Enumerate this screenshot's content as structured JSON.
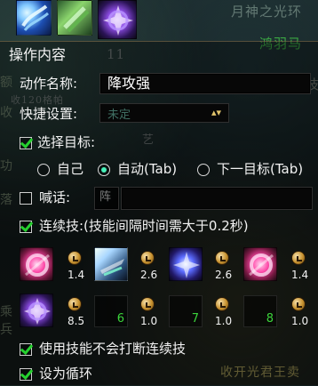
{
  "background": {
    "top_right_text": "月神之光环",
    "name_text": "鸿羽马",
    "level_text": "11",
    "right_side_text": "技",
    "left_side_text_1": "额",
    "left_side_text_2": "收",
    "left_side_text_3": "功",
    "left_side_text_4": "落",
    "left_side_text_5": "乘",
    "left_side_text_6": "兵",
    "bottom_right_text": "收开光君王卖",
    "small_left_text": "收120格帕",
    "small_mid_text": "艺"
  },
  "panel": {
    "header": "操作内容",
    "action_name_label": "动作名称:",
    "action_name_value": "降攻强",
    "shortcut_label": "快捷设置:",
    "shortcut_value": "未定",
    "select_target_label": "选择目标:",
    "radio_self": "自己",
    "radio_auto": "自动(Tab)",
    "radio_next": "下一目标(Tab)",
    "shout_label": "喊话:",
    "shout_placeholder": "阵",
    "combo_label": "连续技:(技能间隔时间需大于0.2秒)",
    "skill_row1": [
      "1.4",
      "2.6",
      "2.6",
      "1.4"
    ],
    "skill_row2": [
      "8.5",
      "1.0",
      "1.0",
      "1.0"
    ],
    "slot_numbers": [
      "6",
      "7",
      "8"
    ],
    "option_no_interrupt": "使用技能不会打断连续技",
    "option_loop": "设为循环"
  },
  "colors": {
    "checkmark": "#26d02f",
    "radio_selected": "#47f0b9",
    "slot_number": "#3bd43b"
  },
  "icons": [
    "wind-skill-icon",
    "leaf-skill-icon",
    "spiral-skill-icon",
    "clock-icon",
    "dropdown-arrow-icon"
  ]
}
